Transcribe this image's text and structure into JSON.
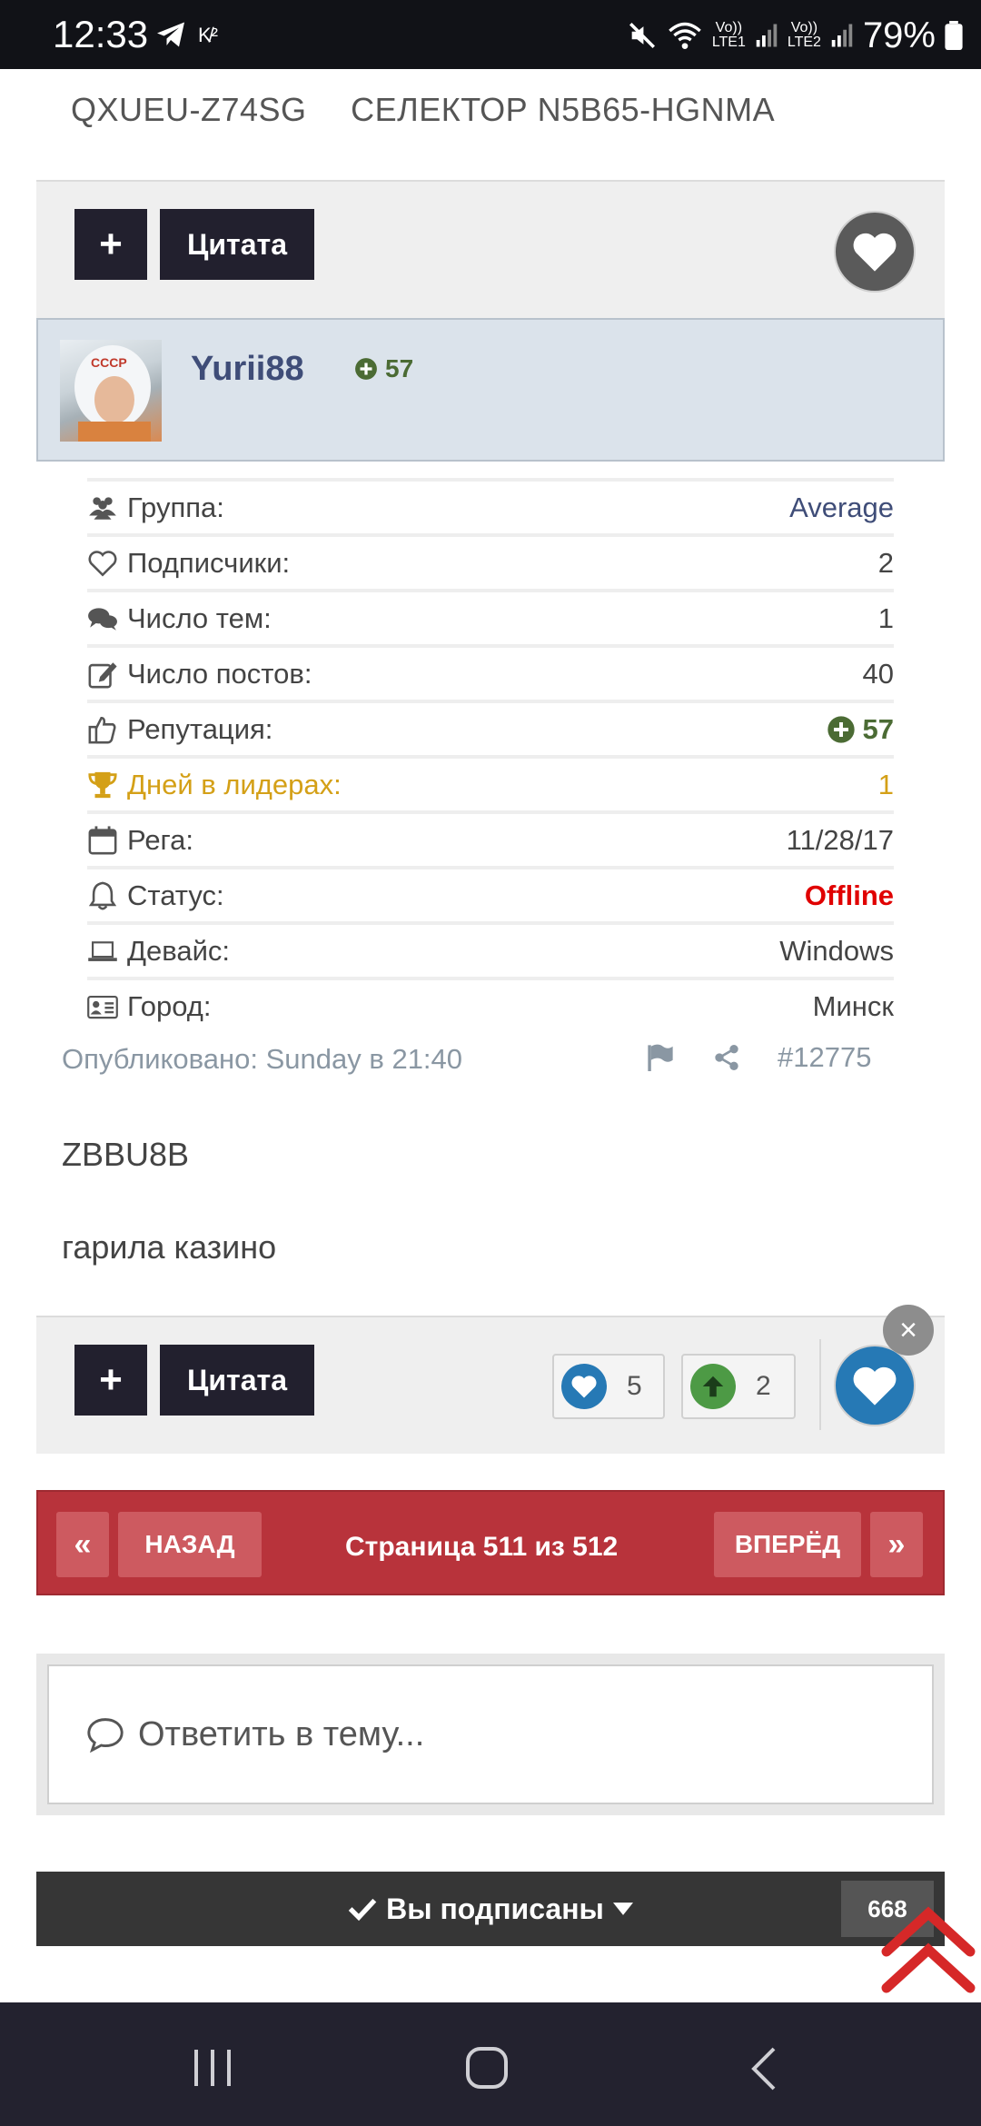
{
  "status_bar": {
    "time": "12:33",
    "lte1": "LTE1",
    "lte2": "LTE2",
    "vo": "Vo))",
    "battery": "79%"
  },
  "topic_header": {
    "left": "QXUEU-Z74SG",
    "right": "СЕЛЕКТОР N5B65-HGNMA"
  },
  "post_actions_top": {
    "plus_label": "+",
    "quote_label": "Цитата"
  },
  "user": {
    "name": "Yurii88",
    "reputation": "57"
  },
  "info": [
    {
      "icon": "users-icon",
      "label": "Группа:",
      "value": "Average",
      "value_color": "#3f4d78"
    },
    {
      "icon": "heart-outline-icon",
      "label": "Подписчики:",
      "value": "2",
      "value_color": "#444444"
    },
    {
      "icon": "comments-icon",
      "label": "Число тем:",
      "value": "1",
      "value_color": "#444444"
    },
    {
      "icon": "edit-icon",
      "label": "Число постов:",
      "value": "40",
      "value_color": "#444444"
    },
    {
      "icon": "thumbs-up-icon",
      "label": "Репутация:",
      "value": "57",
      "value_color": "#4b6b34"
    },
    {
      "icon": "trophy-icon",
      "label": "Дней в лидерах:",
      "value": "1",
      "value_color": "#d4a017"
    },
    {
      "icon": "calendar-icon",
      "label": "Рега:",
      "value": "11/28/17",
      "value_color": "#444444"
    },
    {
      "icon": "bell-icon",
      "label": "Статус:",
      "value": "Offline",
      "value_color": "#e00000"
    },
    {
      "icon": "laptop-icon",
      "label": "Девайс:",
      "value": "Windows",
      "value_color": "#444444"
    },
    {
      "icon": "id-card-icon",
      "label": "Город:",
      "value": "Минск",
      "value_color": "#444444"
    }
  ],
  "post": {
    "published": "Опубликовано: Sunday в 21:40",
    "number": "#12775",
    "line1": "ZBBU8B",
    "line2": "гарила казино"
  },
  "post_actions_bottom": {
    "plus_label": "+",
    "quote_label": "Цитата",
    "likes": "5",
    "upvotes": "2",
    "close": "×"
  },
  "pagination": {
    "first": "«",
    "prev": "НАЗАД",
    "page_text": "Страница 511 из 512",
    "next": "ВПЕРЁД",
    "last": "»"
  },
  "reply": {
    "placeholder": "Ответить в тему..."
  },
  "subscribe": {
    "label": "Вы подписаны",
    "count": "668"
  },
  "colors": {
    "dark_button": "#22202e",
    "like_blue": "#2679b5",
    "upvote_green": "#4d9a45",
    "pager_red": "#b8333b",
    "scroll_top_red": "#d62828"
  }
}
